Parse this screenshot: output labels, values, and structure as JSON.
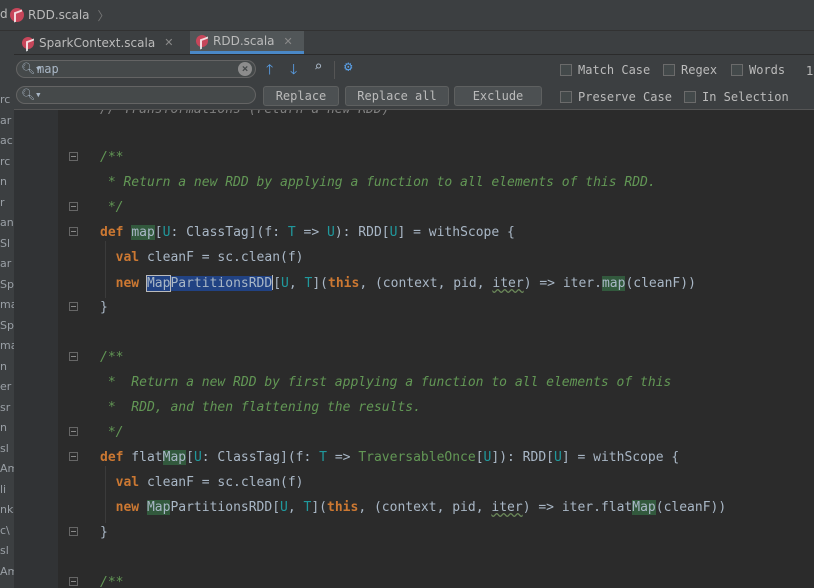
{
  "breadcrumb": {
    "left_cut": "d",
    "file": "RDD.scala"
  },
  "tabs": [
    {
      "label": "SparkContext.scala",
      "active": false
    },
    {
      "label": "RDD.scala",
      "active": true
    }
  ],
  "find": {
    "search_value": "map",
    "replace_value": "",
    "buttons": {
      "replace": "Replace",
      "replace_all": "Replace all",
      "exclude": "Exclude"
    },
    "options": {
      "match_case": "Match Case",
      "regex": "Regex",
      "words": "Words",
      "preserve_case": "Preserve Case",
      "in_selection": "In Selection"
    },
    "count_cut": "1"
  },
  "left_strip_fragments": [
    "rc",
    "ar",
    "ac",
    "rc",
    "n",
    "r",
    "an",
    "Sl",
    "ar",
    "Sp",
    "ma",
    "Sp",
    "ma",
    "n",
    "er",
    "sr",
    "n",
    "sl",
    "Am",
    "li",
    "nk",
    "c\\",
    "sl",
    "Am"
  ],
  "code": {
    "line0": "// Transformations (return a new RDD)",
    "doc1_open": "/**",
    "doc1_l1": " * Return a new RDD by applying a function to all elements of this RDD.",
    "doc1_close": " */",
    "doc2_open": "/**",
    "doc2_l1": " *  Return a new RDD by first applying a function to all elements of this",
    "doc2_l2": " *  RDD, and then flattening the results.",
    "doc2_close": " */",
    "doc3_open": "/**"
  },
  "colors": {
    "background": "#2b2b2b",
    "keyword": "#cc7832",
    "comment": "#629755",
    "type_param": "#20999d",
    "search_highlight": "#32593d",
    "selection": "#214283",
    "active_tab_underline": "#4a88c7"
  }
}
